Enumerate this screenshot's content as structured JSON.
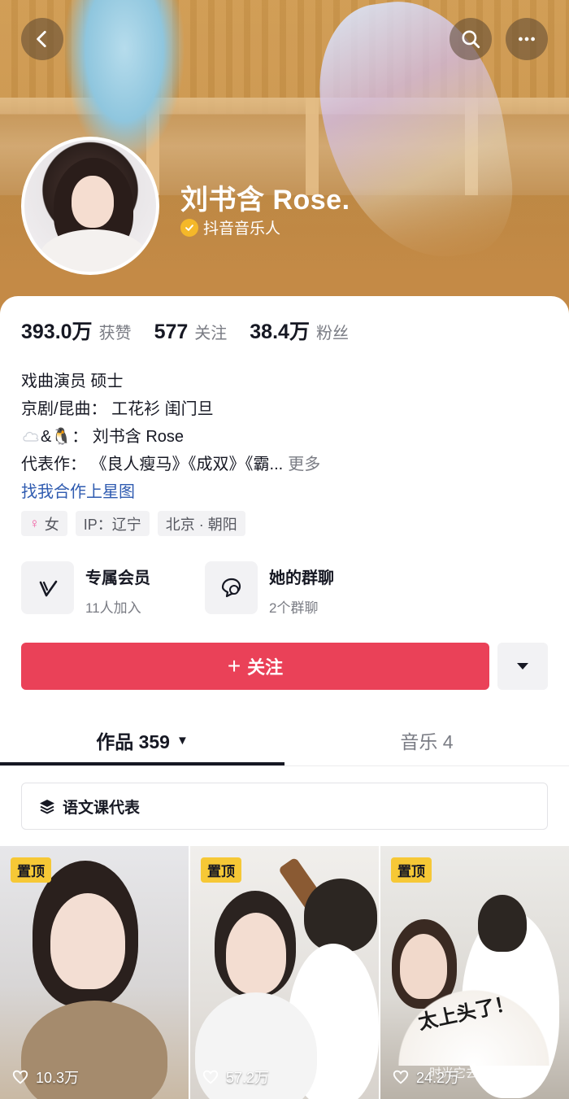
{
  "header": {
    "back_icon": "back-arrow-icon",
    "search_icon": "search-icon",
    "more_icon": "more-horizontal-icon"
  },
  "profile": {
    "name": "刘书含 Rose.",
    "verified_label": "抖音音乐人",
    "verified_color": "#f5b829"
  },
  "stats": [
    {
      "value": "393.0万",
      "label": "获赞"
    },
    {
      "value": "577",
      "label": "关注"
    },
    {
      "value": "38.4万",
      "label": "粉丝"
    }
  ],
  "bio": {
    "line1": "戏曲演员 硕士",
    "line2": "京剧/昆曲： 工花衫 闺门旦",
    "line3_text": "&🐧： 刘书含 Rose",
    "line4_text": "代表作： 《良人瘦马》《成双》《霸...",
    "line4_more": "更多",
    "link": "找我合作上星图"
  },
  "tags": {
    "gender": "女",
    "ip": "IP：辽宁",
    "location": "北京 · 朝阳"
  },
  "features": [
    {
      "title": "专属会员",
      "subtitle": "11人加入",
      "icon": "v-member-icon"
    },
    {
      "title": "她的群聊",
      "subtitle": "2个群聊",
      "icon": "group-chat-icon"
    }
  ],
  "actions": {
    "follow_label": "关注",
    "follow_color": "#ea4158",
    "dropdown_icon": "triangle-down-icon"
  },
  "tabs": [
    {
      "label": "作品 359",
      "active": true
    },
    {
      "label": "音乐 4",
      "active": false
    }
  ],
  "collection": {
    "label": "语文课代表",
    "icon": "layers-icon"
  },
  "videos": [
    {
      "pinned_label": "置顶",
      "likes": "10.3万"
    },
    {
      "pinned_label": "置顶",
      "likes": "57.2万"
    },
    {
      "pinned_label": "置顶",
      "likes": "24.2万",
      "overlay_text": "时光它去不回",
      "fan_text": "太上头了！"
    }
  ]
}
